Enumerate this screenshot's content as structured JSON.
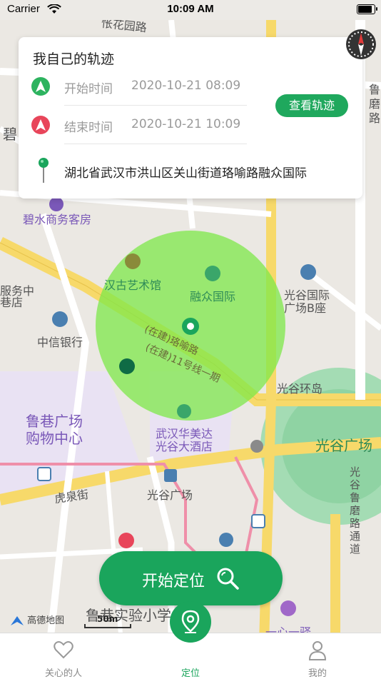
{
  "status_bar": {
    "carrier": "Carrier",
    "time": "10:09 AM",
    "battery_level": 0.95
  },
  "card": {
    "title": "我自己的轨迹",
    "start_label": "开始时间",
    "start_value": "2020-10-21 08:09",
    "end_label": "结束时间",
    "end_value": "2020-10-21 10:09",
    "track_button": "查看轨迹",
    "address": "湖北省武汉市洪山区关山街道珞喻路融众国际"
  },
  "map_labels": {
    "road_top": "怅花园路",
    "biz_hotel": "碧水商务客房",
    "hangu": "汉古艺术馆",
    "rongzhong": "融众国际",
    "guanggu_intl": "光谷国际",
    "guanggu_b": "广场B座",
    "citic": "中信银行",
    "road_luoyu": "(在建)珞喻路",
    "road_line": "(在建)11号线一期",
    "guanggu_ring": "光谷环岛",
    "luxiang": "鲁巷广场",
    "luxiang2": "购物中心",
    "huamei": "武汉华美达",
    "huamei2": "光谷大酒店",
    "guanggu_square": "光谷广场",
    "hubei_road": "光谷鲁磨路通道",
    "huquan": "虎泉街",
    "guanggu_sq2": "光谷广场",
    "school": "鲁巷实验小学",
    "yixin": "一心一驿",
    "left_bi": "碧",
    "left_biz1": "服务中",
    "left_biz2": "巷店",
    "right_lu": "鲁磨路",
    "map_logo": "高德地图",
    "scale": "50m"
  },
  "start_button": {
    "label": "开始定位"
  },
  "tabs": [
    {
      "label": "关心的人",
      "icon": "heart-icon"
    },
    {
      "label": "定位",
      "icon": "location-pin-icon"
    },
    {
      "label": "我的",
      "icon": "person-icon"
    }
  ],
  "colors": {
    "brand_green": "#1aa55c",
    "start_icon": "#2db35f",
    "end_icon": "#e8455a",
    "range_circle": "#7ee84a"
  }
}
